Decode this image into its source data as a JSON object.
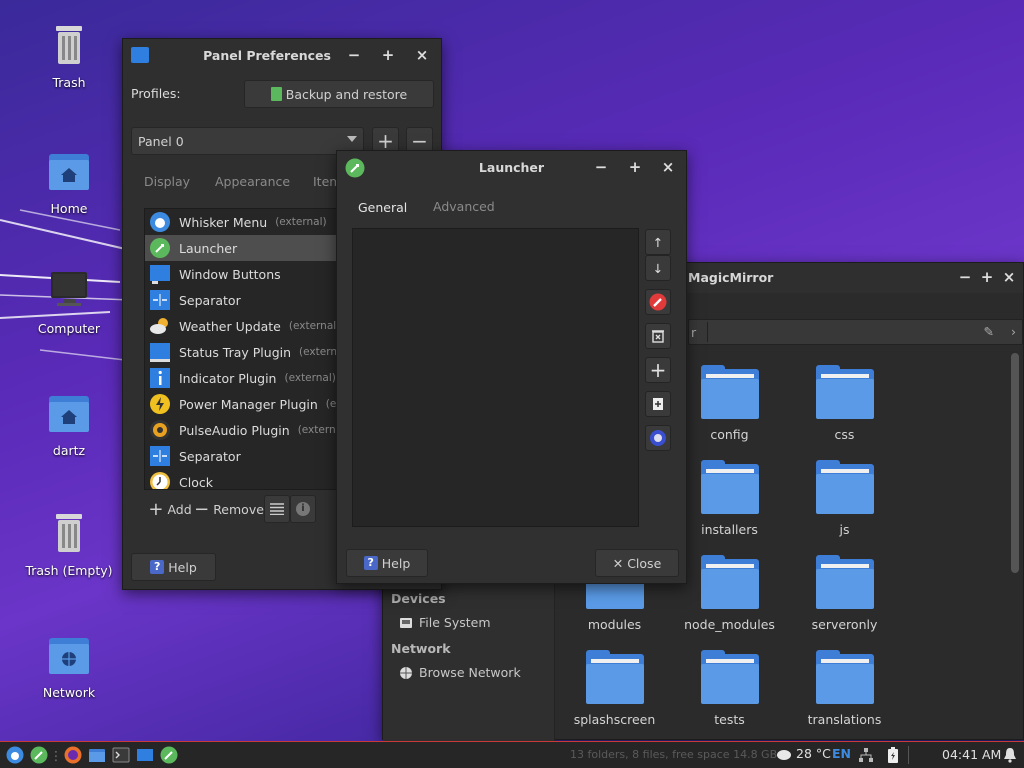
{
  "desktop": {
    "icons": [
      {
        "label": "Trash",
        "icon": "trash-icon"
      },
      {
        "label": "Home",
        "icon": "home-folder-icon"
      },
      {
        "label": "Computer",
        "icon": "computer-icon"
      },
      {
        "label": "dartz",
        "icon": "home-folder-icon"
      },
      {
        "label": "Trash (Empty)",
        "icon": "trash-icon"
      },
      {
        "label": "Network",
        "icon": "network-folder-icon"
      }
    ]
  },
  "panel_prefs": {
    "title": "Panel Preferences",
    "profiles_label": "Profiles:",
    "backup_label": "Backup and restore",
    "panel_select": "Panel 0",
    "tabs": [
      "Display",
      "Appearance",
      "Item"
    ],
    "items": [
      {
        "name": "Whisker Menu",
        "ext": "(external)"
      },
      {
        "name": "Launcher",
        "ext": ""
      },
      {
        "name": "Window Buttons",
        "ext": ""
      },
      {
        "name": "Separator",
        "ext": ""
      },
      {
        "name": "Weather Update",
        "ext": "(external)"
      },
      {
        "name": "Status Tray Plugin",
        "ext": "(external)"
      },
      {
        "name": "Indicator Plugin",
        "ext": "(external)"
      },
      {
        "name": "Power Manager Plugin",
        "ext": "(exter"
      },
      {
        "name": "PulseAudio Plugin",
        "ext": "(external)"
      },
      {
        "name": "Separator",
        "ext": ""
      },
      {
        "name": "Clock",
        "ext": ""
      }
    ],
    "add_label": "Add",
    "remove_label": "Remove",
    "help_label": "Help"
  },
  "launcher": {
    "title": "Launcher",
    "tabs": [
      "General",
      "Advanced"
    ],
    "help_label": "Help",
    "close_label": "Close"
  },
  "file_manager": {
    "title": "MagicMirror",
    "path_fragment": "r",
    "sidebar": {
      "devices_header": "Devices",
      "file_system": "File System",
      "network_header": "Network",
      "browse_network": "Browse Network"
    },
    "folders": [
      "config",
      "css",
      "installers",
      "js",
      "modules",
      "node_modules",
      "serveronly",
      "splashscreen",
      "tests",
      "translations"
    ],
    "status_text": "13 folders, 8 files, free space 14.8 GB"
  },
  "taskbar": {
    "temperature": "28 °C",
    "language": "EN",
    "time": "04:41 AM"
  },
  "colors": {
    "accent_green": "#5cb85c",
    "folder_blue": "#4a8ee0",
    "taskbar_border": "#c83a3a"
  }
}
